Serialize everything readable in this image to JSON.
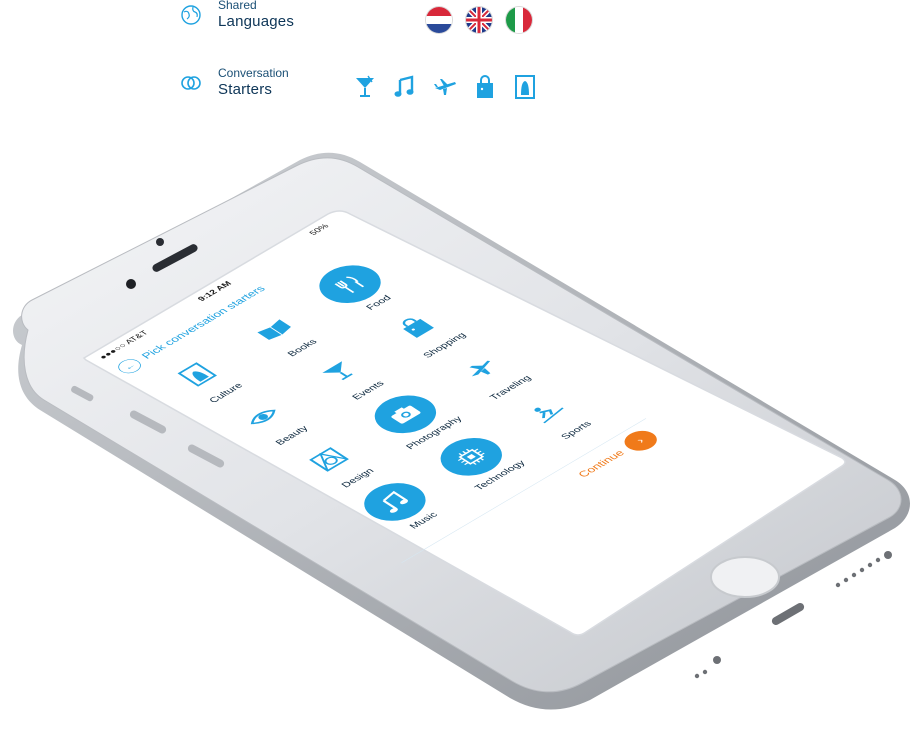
{
  "shared_languages": {
    "small_label": "Shared",
    "big_label": "Languages",
    "flags": [
      "netherlands-flag",
      "uk-flag",
      "italy-flag"
    ]
  },
  "conversation_starters": {
    "small_label": "Conversation",
    "big_label": "Starters",
    "icons": [
      "cocktail-icon",
      "music-note-icon",
      "airplane-icon",
      "shopping-bag-icon",
      "museum-frame-icon"
    ]
  },
  "phone": {
    "status_bar": {
      "carrier": "●●●○○ AT&T",
      "time": "9:12 AM",
      "battery": "50%"
    },
    "title": "Pick conversation starters",
    "topics": [
      {
        "label": "Culture",
        "icon": "culture-frame-icon",
        "selected": false
      },
      {
        "label": "Books",
        "icon": "book-icon",
        "selected": false
      },
      {
        "label": "Food",
        "icon": "fork-knife-icon",
        "selected": true
      },
      {
        "label": "Beauty",
        "icon": "eye-icon",
        "selected": false
      },
      {
        "label": "Events",
        "icon": "cocktail-icon",
        "selected": false
      },
      {
        "label": "Shopping",
        "icon": "shopping-bag-icon",
        "selected": false
      },
      {
        "label": "Design",
        "icon": "design-icon",
        "selected": false
      },
      {
        "label": "Photography",
        "icon": "camera-icon",
        "selected": true
      },
      {
        "label": "Traveling",
        "icon": "airplane-icon",
        "selected": false
      },
      {
        "label": "Music",
        "icon": "music-note-icon",
        "selected": true
      },
      {
        "label": "Technology",
        "icon": "chip-icon",
        "selected": true
      },
      {
        "label": "Sports",
        "icon": "skier-icon",
        "selected": false
      }
    ],
    "continue_label": "Continue"
  },
  "colors": {
    "accent": "#1fa2e0",
    "continue": "#f07a1a",
    "navy": "#0d3557"
  }
}
